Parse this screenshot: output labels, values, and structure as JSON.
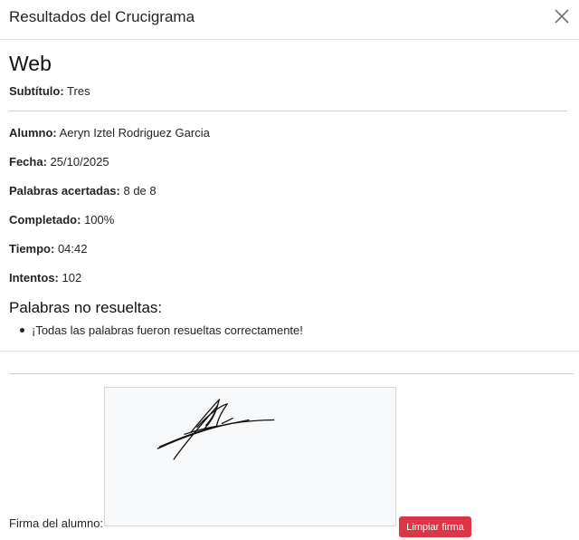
{
  "modal": {
    "title": "Resultados del Crucigrama",
    "close_icon": "close-icon"
  },
  "crossword": {
    "title": "Web",
    "subtitle_label": "Subtítulo:",
    "subtitle_value": "Tres"
  },
  "details": {
    "student_label": "Alumno:",
    "student_value": "Aeryn Iztel Rodriguez Garcia",
    "date_label": "Fecha:",
    "date_value": "25/10/2025",
    "words_label": "Palabras acertadas:",
    "words_value": "8 de 8",
    "completed_label": "Completado:",
    "completed_value": "100%",
    "time_label": "Tiempo:",
    "time_value": "04:42",
    "attempts_label": "Intentos:",
    "attempts_value": "102"
  },
  "unsolved": {
    "title": "Palabras no resueltas:",
    "items": [
      "¡Todas las palabras fueron resueltas correctamente!"
    ]
  },
  "signature": {
    "label": "Firma del alumno:",
    "clear_button": "Limpiar firma"
  },
  "colors": {
    "danger": "#dc3545",
    "canvas_bg": "#f7f8fa",
    "divider": "#dee2e6"
  }
}
